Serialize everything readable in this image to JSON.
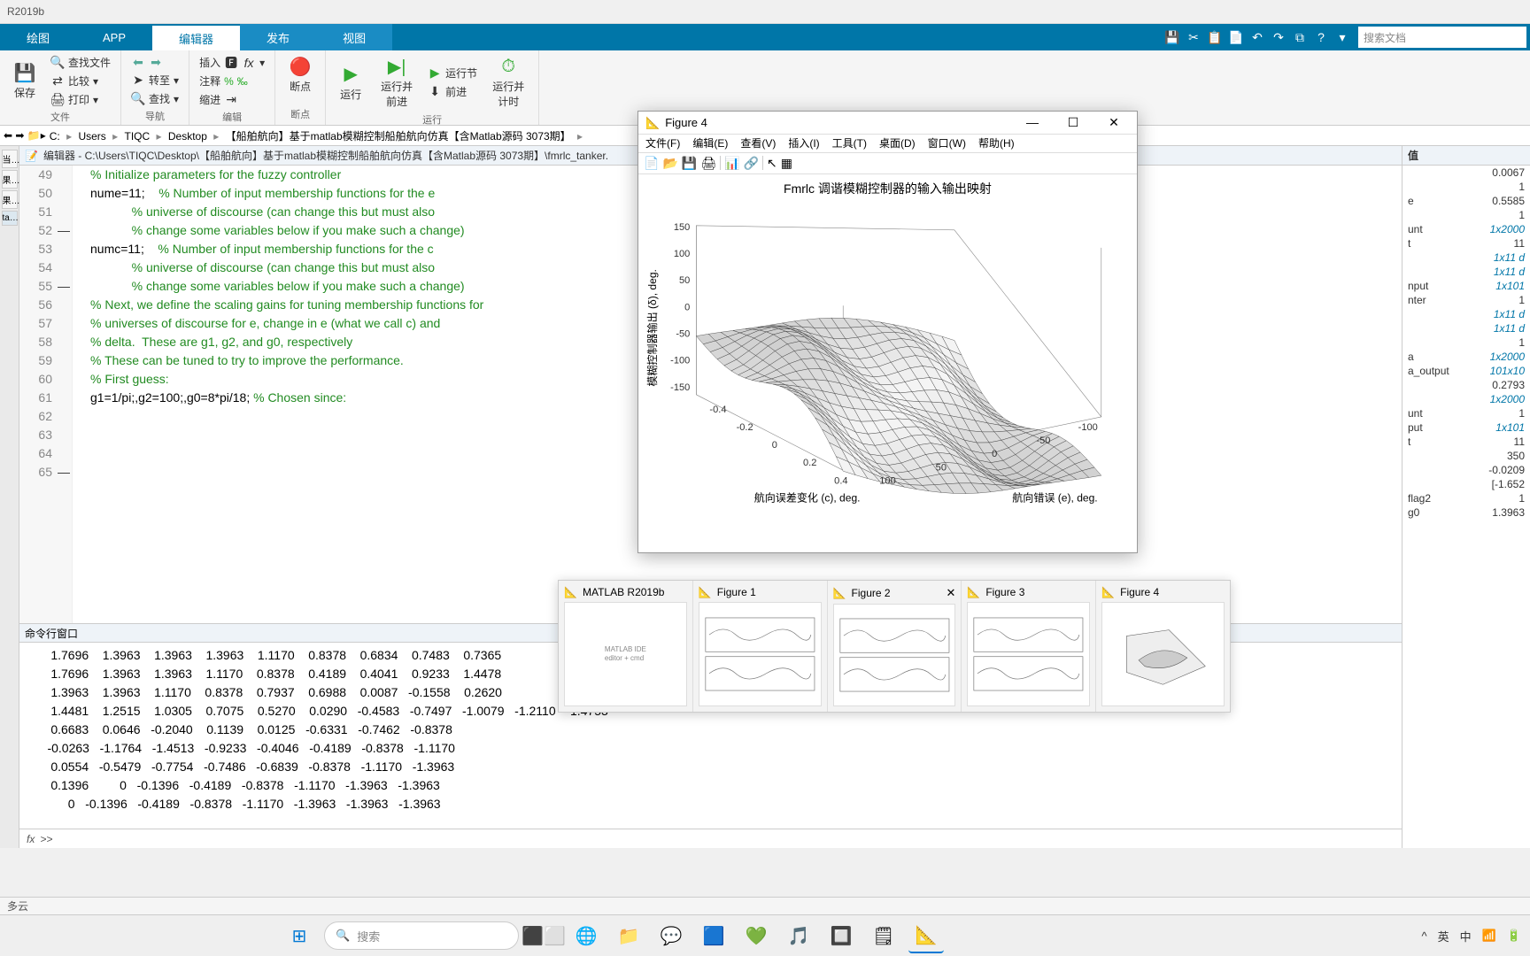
{
  "titlebar": "R2019b",
  "tabs": {
    "plot": "绘图",
    "app": "APP",
    "editor": "编辑器",
    "publish": "发布",
    "view": "视图"
  },
  "search_placeholder": "搜索文档",
  "ribbon": {
    "file": {
      "label": "文件",
      "save": "保存",
      "find_files": "查找文件",
      "compare": "比较",
      "print": "打印"
    },
    "nav": {
      "label": "导航",
      "goto": "转至",
      "find": "查找"
    },
    "edit": {
      "label": "编辑",
      "insert": "插入",
      "comment": "注释",
      "indent": "缩进"
    },
    "bp": {
      "label": "断点",
      "breakpoints": "断点"
    },
    "run": {
      "label": "运行",
      "run": "运行",
      "run_adv": "运行并\n前进",
      "run_sec": "运行节",
      "advance": "前进",
      "run_time": "运行并\n计时"
    }
  },
  "path": [
    "C:",
    "Users",
    "TIQC",
    "Desktop",
    "【船舶航向】基于matlab模糊控制船舶航向仿真【含Matlab源码 3073期】"
  ],
  "editor_title": "编辑器 - C:\\Users\\TIQC\\Desktop\\【船舶航向】基于matlab模糊控制船舶航向仿真【含Matlab源码 3073期】\\fmrlc_tanker.",
  "lines": [
    {
      "n": 49,
      "t": ""
    },
    {
      "n": 50,
      "t": "% Initialize parameters for the fuzzy controller",
      "c": true
    },
    {
      "n": 51,
      "t": ""
    },
    {
      "n": 52,
      "m": "—",
      "t": "nume=11;    % Number of input membership functions for the e"
    },
    {
      "n": 53,
      "t": "            % universe of discourse (can change this but must also",
      "c": true
    },
    {
      "n": 54,
      "t": "            % change some variables below if you make such a change)",
      "c": true
    },
    {
      "n": 55,
      "m": "—",
      "t": "numc=11;    % Number of input membership functions for the c"
    },
    {
      "n": 56,
      "t": "            % universe of discourse (can change this but must also",
      "c": true
    },
    {
      "n": 57,
      "t": "            % change some variables below if you make such a change)",
      "c": true
    },
    {
      "n": 58,
      "t": ""
    },
    {
      "n": 59,
      "t": "% Next, we define the scaling gains for tuning membership functions for",
      "c": true
    },
    {
      "n": 60,
      "t": "% universes of discourse for e, change in e (what we call c) and",
      "c": true
    },
    {
      "n": 61,
      "t": "% delta.  These are g1, g2, and g0, respectively",
      "c": true
    },
    {
      "n": 62,
      "t": "% These can be tuned to try to improve the performance.",
      "c": true
    },
    {
      "n": 63,
      "t": ""
    },
    {
      "n": 64,
      "t": "% First guess:",
      "c": true
    },
    {
      "n": 65,
      "m": "—",
      "t": "g1=1/pi;,g2=100;,g0=8*pi/18; % Chosen since:"
    }
  ],
  "cmd_header": "命令行窗口",
  "cmd_rows": [
    [
      "1.7696",
      "1.3963",
      "1.3963",
      "1.3963",
      "1.1170",
      "0.8378",
      "0.6834",
      "0.7483",
      "0.7365"
    ],
    [
      "1.7696",
      "1.3963",
      "1.3963",
      "1.1170",
      "0.8378",
      "0.4189",
      "0.4041",
      "0.9233",
      "1.4478"
    ],
    [
      "1.3963",
      "1.3963",
      "1.1170",
      "0.8378",
      "0.7937",
      "0.6988",
      "0.0087",
      "-0.1558",
      "0.2620"
    ],
    [
      "1.4481",
      "1.2515",
      "1.0305",
      "0.7075",
      "0.5270",
      "0.0290",
      "-0.4583",
      "-0.7497",
      "-1.0079",
      "-1.2110",
      "-1.4753"
    ],
    [
      "0.6683",
      "0.0646",
      "-0.2040",
      "0.1139",
      "0.0125",
      "-0.6331",
      "-0.7462",
      "-0.8378"
    ],
    [
      "-0.0263",
      "-1.1764",
      "-1.4513",
      "-0.9233",
      "-0.4046",
      "-0.4189",
      "-0.8378",
      "-1.1170"
    ],
    [
      "0.0554",
      "-0.5479",
      "-0.7754",
      "-0.7486",
      "-0.6839",
      "-0.8378",
      "-1.1170",
      "-1.3963"
    ],
    [
      "0.1396",
      "0",
      "-0.1396",
      "-0.4189",
      "-0.8378",
      "-1.1170",
      "-1.3963",
      "-1.3963"
    ],
    [
      "0",
      "-0.1396",
      "-0.4189",
      "-0.8378",
      "-1.1170",
      "-1.3963",
      "-1.3963",
      "-1.3963"
    ]
  ],
  "cmd_prompt": "fx >>",
  "workspace": {
    "header": "值",
    "rows": [
      {
        "v": "0.0067"
      },
      {
        "v": "1"
      },
      {
        "n": "e",
        "v": "0.5585"
      },
      {
        "v": "1"
      },
      {
        "n": "unt",
        "v": "1x2000",
        "a": true
      },
      {
        "n": "t",
        "v": "11"
      },
      {
        "v": "1x11 d",
        "a": true
      },
      {
        "v": "1x11 d",
        "a": true
      },
      {
        "n": "nput",
        "v": "1x101",
        "a": true
      },
      {
        "n": "nter",
        "v": "1"
      },
      {
        "v": "1x11 d",
        "a": true
      },
      {
        "v": "1x11 d",
        "a": true
      },
      {
        "v": "1"
      },
      {
        "n": "a",
        "v": "1x2000",
        "a": true
      },
      {
        "n": "a_output",
        "v": "101x10",
        "a": true
      },
      {
        "v": "0.2793"
      },
      {
        "v": "1x2000",
        "a": true
      },
      {
        "n": "unt",
        "v": "1"
      },
      {
        "n": "put",
        "v": "1x101",
        "a": true
      },
      {
        "n": "t",
        "v": "11"
      },
      {
        "v": "350"
      },
      {
        "v": "-0.0209"
      },
      {
        "v": "[-1.652"
      },
      {
        "n": "flag2",
        "v": "1"
      },
      {
        "n": "g0",
        "v": "1.3963"
      }
    ]
  },
  "figure": {
    "title": "Figure 4",
    "menus": [
      "文件(F)",
      "编辑(E)",
      "查看(V)",
      "插入(I)",
      "工具(T)",
      "桌面(D)",
      "窗口(W)",
      "帮助(H)"
    ],
    "plot_title": "Fmrlc 调谐模糊控制器的输入输出映射",
    "zlabel": "模糊控制器输出 (δ), deg.",
    "xlabel": "航向误差变化 (c), deg.",
    "ylabel": "航向错误 (e), deg.",
    "zticks": [
      "-150",
      "-100",
      "-50",
      "0",
      "50",
      "100",
      "150"
    ],
    "xticks": [
      "-0.4",
      "-0.2",
      "0",
      "0.2",
      "0.4"
    ],
    "yticks": [
      "-100",
      "-50",
      "0",
      "50",
      "100"
    ]
  },
  "chart_data": {
    "type": "surface",
    "title": "Fmrlc 调谐模糊控制器的输入输出映射",
    "xlabel": "航向误差变化 (c), deg.",
    "ylabel": "航向错误 (e), deg.",
    "zlabel": "模糊控制器输出 (δ), deg.",
    "xlim": [
      -0.4,
      0.4
    ],
    "ylim": [
      -100,
      100
    ],
    "zlim": [
      -150,
      150
    ],
    "xticks": [
      -0.4,
      -0.2,
      0,
      0.2,
      0.4
    ],
    "yticks": [
      -100,
      -50,
      0,
      50,
      100
    ],
    "zticks": [
      -150,
      -100,
      -50,
      0,
      50,
      100,
      150
    ],
    "note": "3D fuzzy controller surface mesh; approximate saddle-like shape rising toward (-c,+e) and (+c,-e) corners"
  },
  "previews": [
    {
      "label": "MATLAB R2019b"
    },
    {
      "label": "Figure 1"
    },
    {
      "label": "Figure 2",
      "close": true
    },
    {
      "label": "Figure 3"
    },
    {
      "label": "Figure 4"
    }
  ],
  "status": "多云",
  "taskbar_search": "搜索"
}
